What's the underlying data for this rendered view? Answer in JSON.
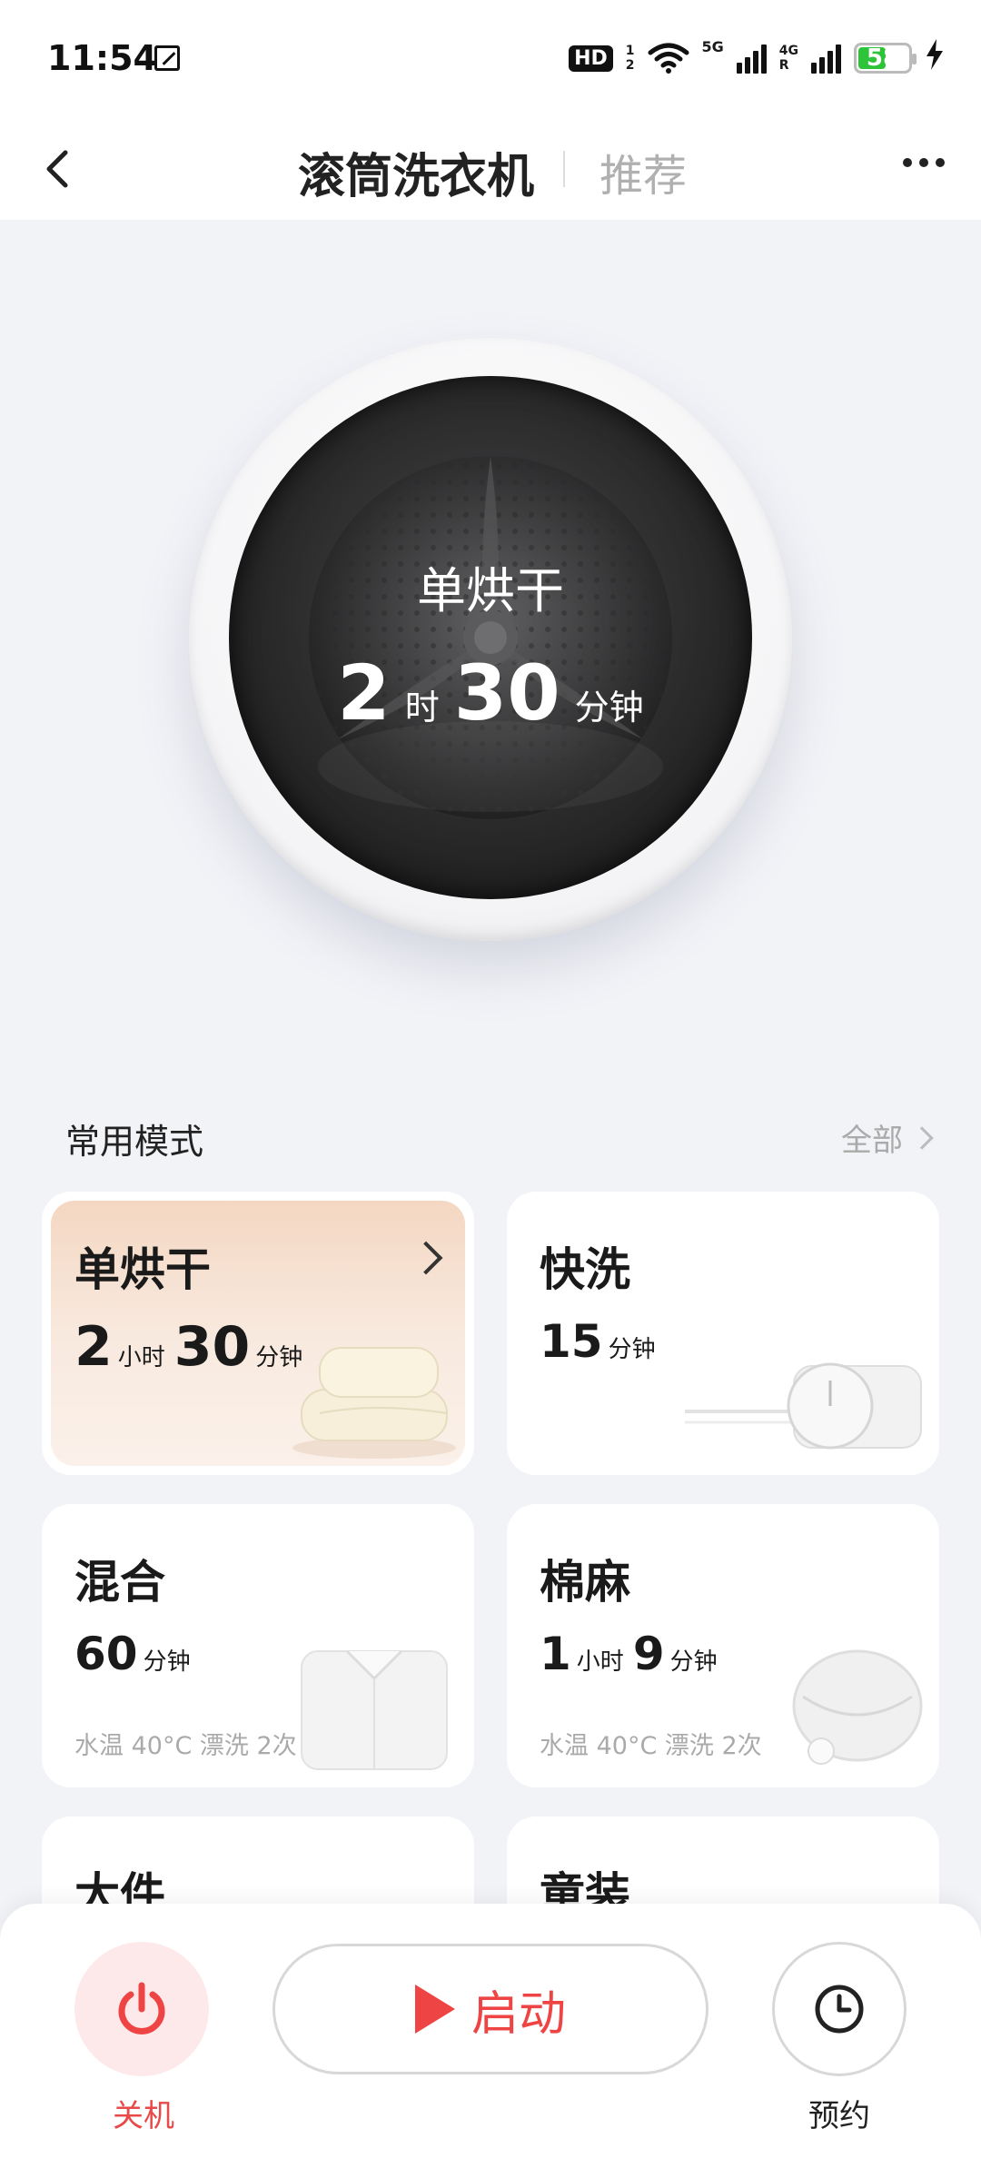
{
  "status_bar": {
    "time": "11:54",
    "hd": "HD",
    "sim_top": "1",
    "sim_bottom": "2",
    "wifi_label": "5",
    "net1": "5G",
    "net2": "4G",
    "roaming": "R",
    "battery": "58",
    "battery_level": 0.58,
    "battery_color": "#2ec43a"
  },
  "header": {
    "title": "滚筒洗衣机",
    "recommend": "推荐"
  },
  "drum": {
    "mode": "单烘干",
    "hours": "2",
    "hours_unit": "时",
    "minutes": "30",
    "minutes_unit": "分钟"
  },
  "section": {
    "title": "常用模式",
    "all": "全部"
  },
  "cards": [
    {
      "title": "单烘干",
      "num1": "2",
      "unit1": "小时",
      "num2": "30",
      "unit2": "分钟",
      "sub": ""
    },
    {
      "title": "快洗",
      "num1": "15",
      "unit1": "分钟",
      "num2": "",
      "unit2": "",
      "sub": ""
    },
    {
      "title": "混合",
      "num1": "60",
      "unit1": "分钟",
      "num2": "",
      "unit2": "",
      "sub": "水温 40°C 漂洗 2次"
    },
    {
      "title": "棉麻",
      "num1": "1",
      "unit1": "小时",
      "num2": "9",
      "unit2": "分钟",
      "sub": "水温 40°C 漂洗 2次"
    },
    {
      "title": "大件"
    },
    {
      "title": "童装"
    }
  ],
  "bottom": {
    "power_label": "关机",
    "start_label": "启动",
    "schedule_label": "预约",
    "accent": "#ef4444"
  }
}
